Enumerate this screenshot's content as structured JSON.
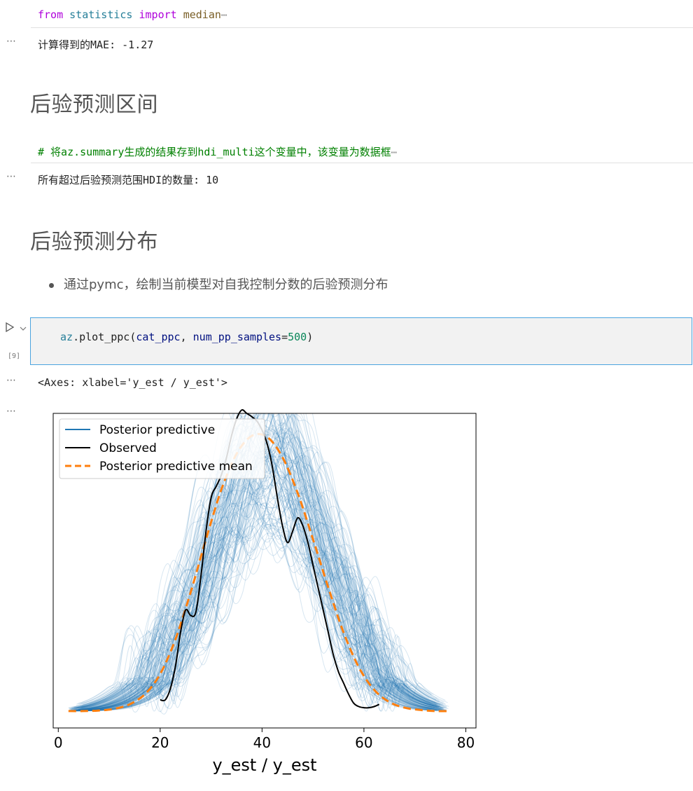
{
  "cell1": {
    "code": {
      "kw1": "from",
      "mod": "statistics",
      "kw2": "import",
      "fn": "median",
      "ellipsis": "⋯"
    },
    "output_gutter": "⋯",
    "output": "计算得到的MAE: -1.27"
  },
  "heading1": "后验预测区间",
  "cell2": {
    "code": "# 将az.summary生成的结果存到hdi_multi这个变量中，该变量为数据框",
    "ellipsis": "⋯",
    "output_gutter": "⋯",
    "output": "所有超过后验预测范围HDI的数量: 10"
  },
  "heading2": "后验预测分布",
  "bullet": "通过pymc，绘制当前模型对自我控制分数的后验预测分布",
  "cell3": {
    "run_icon": "play-icon",
    "collapse_icon": "chevron-down-icon",
    "exec_count": "[9]",
    "code": {
      "obj": "az",
      "call": ".plot_ppc(",
      "arg1": "cat_ppc",
      "comma": ", ",
      "kw": "num_pp_samples",
      "eq": "=",
      "num": "500",
      "close": ")"
    },
    "output_gutter1": "⋯",
    "output_text": "<Axes: xlabel='y_est / y_est'>",
    "output_gutter2": "⋯"
  },
  "chart_data": {
    "type": "line",
    "xlabel": "y_est / y_est",
    "ylabel": "",
    "xlim": [
      -1,
      82
    ],
    "ylim": [
      -0.0015,
      0.0265
    ],
    "xticks": [
      0,
      20,
      40,
      60,
      80
    ],
    "yticks_visible": false,
    "legend": {
      "placement": "top-left",
      "entries": [
        "Posterior predictive",
        "Observed",
        "Posterior predictive mean"
      ]
    },
    "colors": {
      "posterior": "#1f77b4",
      "observed": "#000000",
      "mean": "#ff7f0e"
    },
    "posterior_predictive": {
      "num_pp_samples": 500,
      "x_range": [
        2,
        77
      ],
      "center": 41,
      "sd": 11.5,
      "peak_range": [
        0.0165,
        0.028
      ]
    },
    "observed": {
      "x": [
        20,
        21,
        22,
        23,
        24,
        25,
        26,
        27,
        28,
        29,
        30,
        31,
        32,
        33,
        34,
        35,
        36,
        37,
        38,
        39,
        40,
        41,
        42,
        43,
        44,
        45,
        46,
        47,
        48,
        49,
        50,
        51,
        52,
        53,
        54,
        55,
        56,
        57,
        58,
        59,
        60,
        61,
        62,
        63
      ],
      "y": [
        0.001,
        0.001,
        0.002,
        0.004,
        0.007,
        0.009,
        0.0085,
        0.0088,
        0.012,
        0.016,
        0.019,
        0.02,
        0.021,
        0.0225,
        0.0245,
        0.026,
        0.0268,
        0.0265,
        0.0262,
        0.0258,
        0.025,
        0.0238,
        0.0218,
        0.019,
        0.0165,
        0.015,
        0.016,
        0.0172,
        0.0165,
        0.015,
        0.013,
        0.011,
        0.009,
        0.007,
        0.005,
        0.0035,
        0.0025,
        0.0015,
        0.0007,
        0.0004,
        0.0003,
        0.0003,
        0.0004,
        0.0006
      ]
    },
    "posterior_predictive_mean": {
      "x": [
        2,
        5,
        8,
        11,
        14,
        17,
        20,
        23,
        26,
        29,
        32,
        35,
        38,
        41,
        44,
        47,
        50,
        53,
        56,
        59,
        62,
        65,
        68,
        71,
        74,
        77
      ],
      "y": [
        0.0,
        0.0,
        5e-05,
        0.0002,
        0.0006,
        0.0015,
        0.0033,
        0.0064,
        0.0106,
        0.0153,
        0.0197,
        0.0229,
        0.0245,
        0.0244,
        0.0226,
        0.0194,
        0.0153,
        0.011,
        0.007,
        0.0039,
        0.0019,
        0.0008,
        0.0003,
        0.0001,
        0.0,
        0.0
      ]
    }
  }
}
